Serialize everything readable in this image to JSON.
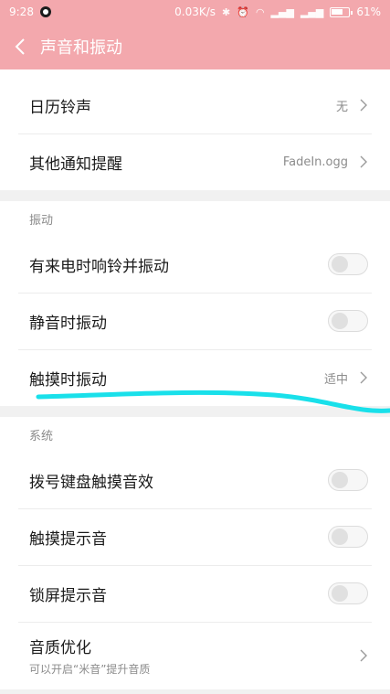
{
  "status_bar": {
    "time": "9:28",
    "net_speed": "0.03K/s",
    "battery": "61%"
  },
  "header": {
    "title": "声音和振动"
  },
  "rows_top": [
    {
      "label": "日历铃声",
      "value": "无"
    },
    {
      "label": "其他通知提醒",
      "value": "FadeIn.ogg"
    }
  ],
  "vibration": {
    "header": "振动",
    "items": [
      {
        "label": "有来电时响铃并振动",
        "on": false
      },
      {
        "label": "静音时振动",
        "on": false
      },
      {
        "label": "触摸时振动",
        "value": "适中"
      }
    ]
  },
  "system": {
    "header": "系统",
    "items": [
      {
        "label": "拨号键盘触摸音效",
        "on": false
      },
      {
        "label": "触摸提示音",
        "on": false
      },
      {
        "label": "锁屏提示音",
        "on": false
      }
    ],
    "quality": {
      "label": "音质优化",
      "sub": "可以开启“米音”提升音质"
    }
  },
  "colors": {
    "header_bg": "#f3a8ad",
    "annotation": "#19e0ea"
  }
}
